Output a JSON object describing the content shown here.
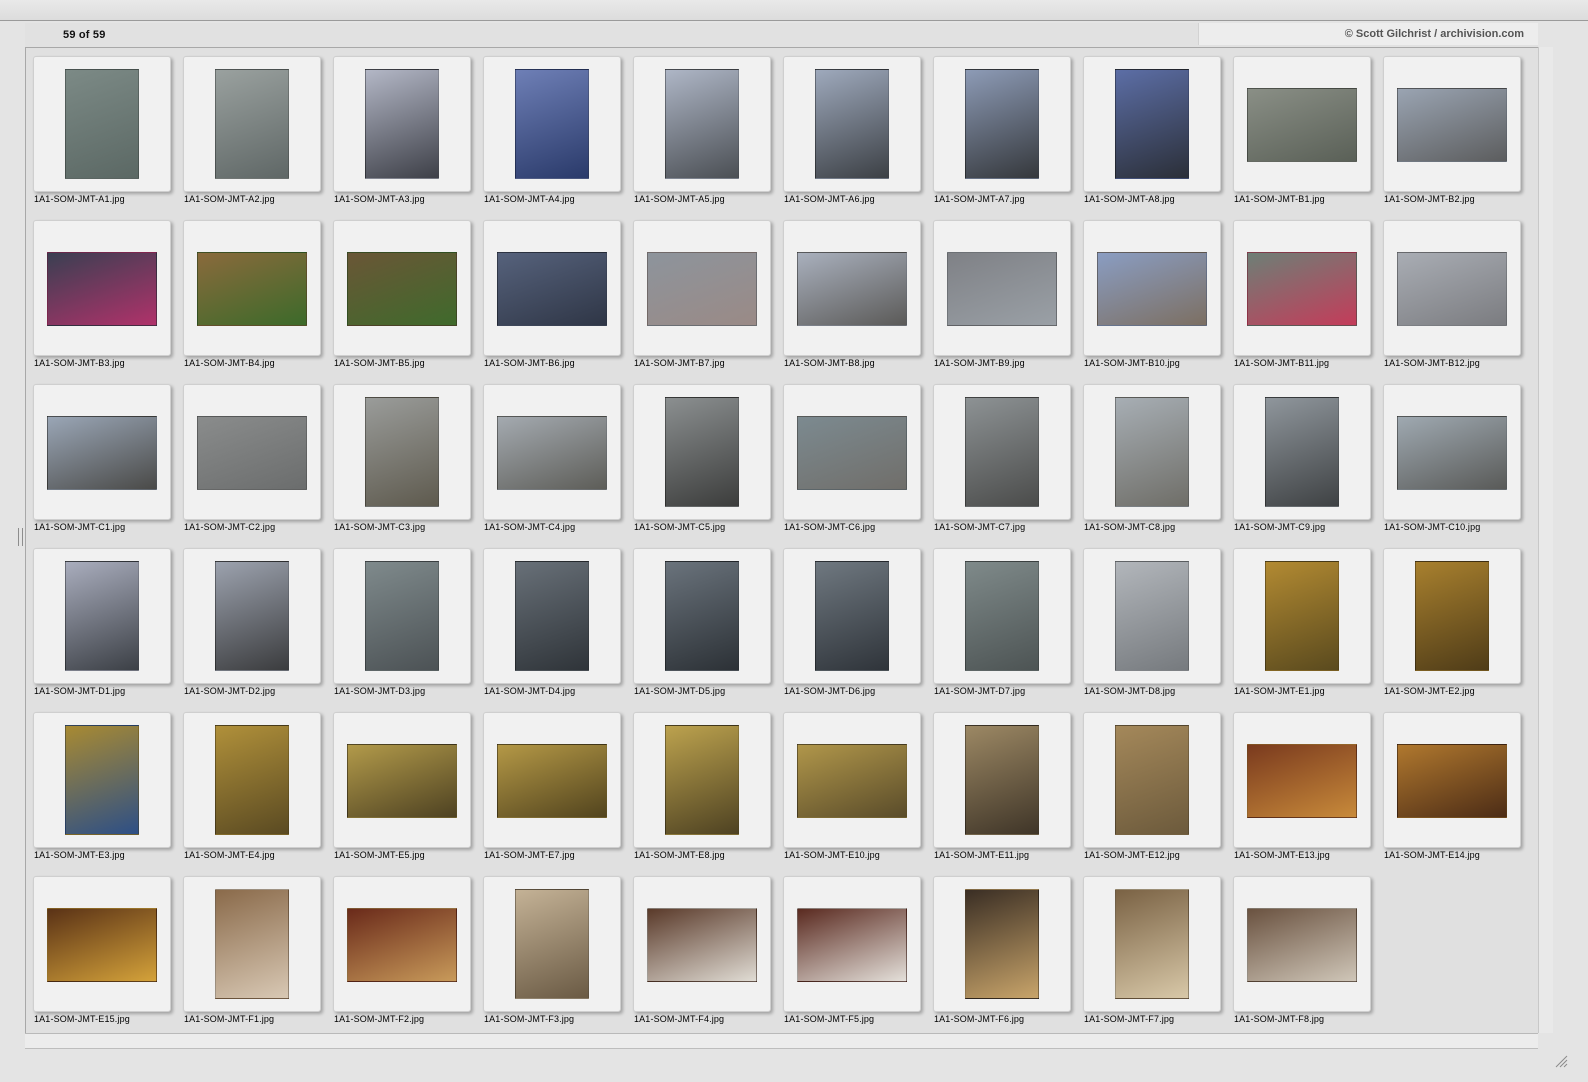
{
  "window": {
    "image_count": "59 of 59",
    "credit": "© Scott Gilchrist / archivision.com"
  },
  "thumbnails": [
    {
      "name": "1A1-SOM-JMT-A1.jpg",
      "orient": "portrait",
      "c1": "#7c8a86",
      "c2": "#5b6864"
    },
    {
      "name": "1A1-SOM-JMT-A2.jpg",
      "orient": "portrait",
      "c1": "#9aa19f",
      "c2": "#5f6766"
    },
    {
      "name": "1A1-SOM-JMT-A3.jpg",
      "orient": "portrait",
      "c1": "#b3b7c6",
      "c2": "#3e4048"
    },
    {
      "name": "1A1-SOM-JMT-A4.jpg",
      "orient": "portrait",
      "c1": "#6e7fb6",
      "c2": "#2a3a6a"
    },
    {
      "name": "1A1-SOM-JMT-A5.jpg",
      "orient": "portrait",
      "c1": "#aeb6c6",
      "c2": "#4b4f54"
    },
    {
      "name": "1A1-SOM-JMT-A6.jpg",
      "orient": "portrait",
      "c1": "#9ea9bc",
      "c2": "#3c4045"
    },
    {
      "name": "1A1-SOM-JMT-A7.jpg",
      "orient": "portrait",
      "c1": "#8d9bb6",
      "c2": "#35383c"
    },
    {
      "name": "1A1-SOM-JMT-A8.jpg",
      "orient": "portrait",
      "c1": "#5c6ea6",
      "c2": "#2b2f38"
    },
    {
      "name": "1A1-SOM-JMT-B1.jpg",
      "orient": "landscape",
      "c1": "#8a8f86",
      "c2": "#5a6057"
    },
    {
      "name": "1A1-SOM-JMT-B2.jpg",
      "orient": "landscape",
      "c1": "#9aa4b2",
      "c2": "#5c5d5e"
    },
    {
      "name": "1A1-SOM-JMT-B3.jpg",
      "orient": "landscape",
      "c1": "#3a3f52",
      "c2": "#b0326a"
    },
    {
      "name": "1A1-SOM-JMT-B4.jpg",
      "orient": "landscape",
      "c1": "#8a6a3c",
      "c2": "#3c6a2a"
    },
    {
      "name": "1A1-SOM-JMT-B5.jpg",
      "orient": "landscape",
      "c1": "#6a5636",
      "c2": "#3f6a2c"
    },
    {
      "name": "1A1-SOM-JMT-B6.jpg",
      "orient": "landscape",
      "c1": "#56627c",
      "c2": "#2f3646"
    },
    {
      "name": "1A1-SOM-JMT-B7.jpg",
      "orient": "landscape",
      "c1": "#8d949c",
      "c2": "#9a8a86"
    },
    {
      "name": "1A1-SOM-JMT-B8.jpg",
      "orient": "landscape",
      "c1": "#a9b0bd",
      "c2": "#5b5a58"
    },
    {
      "name": "1A1-SOM-JMT-B9.jpg",
      "orient": "landscape",
      "c1": "#7f8186",
      "c2": "#9aa0a6"
    },
    {
      "name": "1A1-SOM-JMT-B10.jpg",
      "orient": "landscape",
      "c1": "#8a9dc2",
      "c2": "#7c6f62"
    },
    {
      "name": "1A1-SOM-JMT-B11.jpg",
      "orient": "landscape",
      "c1": "#6d7f76",
      "c2": "#c43c5a"
    },
    {
      "name": "1A1-SOM-JMT-B12.jpg",
      "orient": "landscape",
      "c1": "#a9adb4",
      "c2": "#7b7c80"
    },
    {
      "name": "1A1-SOM-JMT-C1.jpg",
      "orient": "landscape",
      "c1": "#9aa6b6",
      "c2": "#4a4a48"
    },
    {
      "name": "1A1-SOM-JMT-C2.jpg",
      "orient": "landscape",
      "c1": "#8a8c8c",
      "c2": "#6b6d6d"
    },
    {
      "name": "1A1-SOM-JMT-C3.jpg",
      "orient": "portrait",
      "c1": "#9a9c9a",
      "c2": "#5e5a4e"
    },
    {
      "name": "1A1-SOM-JMT-C4.jpg",
      "orient": "landscape",
      "c1": "#a4aab0",
      "c2": "#5d5d58"
    },
    {
      "name": "1A1-SOM-JMT-C5.jpg",
      "orient": "portrait",
      "c1": "#8b8f90",
      "c2": "#3c3d3c"
    },
    {
      "name": "1A1-SOM-JMT-C6.jpg",
      "orient": "landscape",
      "c1": "#7c8a90",
      "c2": "#706e6a"
    },
    {
      "name": "1A1-SOM-JMT-C7.jpg",
      "orient": "portrait",
      "c1": "#8d9294",
      "c2": "#4b4c4b"
    },
    {
      "name": "1A1-SOM-JMT-C8.jpg",
      "orient": "portrait",
      "c1": "#a7aeb4",
      "c2": "#6f6e68"
    },
    {
      "name": "1A1-SOM-JMT-C9.jpg",
      "orient": "portrait",
      "c1": "#8f969c",
      "c2": "#3f4244"
    },
    {
      "name": "1A1-SOM-JMT-C10.jpg",
      "orient": "landscape",
      "c1": "#9fa9b1",
      "c2": "#595a58"
    },
    {
      "name": "1A1-SOM-JMT-D1.jpg",
      "orient": "portrait",
      "c1": "#a9adbd",
      "c2": "#3c4046"
    },
    {
      "name": "1A1-SOM-JMT-D2.jpg",
      "orient": "portrait",
      "c1": "#9ca2ae",
      "c2": "#3b3c3e"
    },
    {
      "name": "1A1-SOM-JMT-D3.jpg",
      "orient": "portrait",
      "c1": "#7f8a8c",
      "c2": "#4c5255"
    },
    {
      "name": "1A1-SOM-JMT-D4.jpg",
      "orient": "portrait",
      "c1": "#687078",
      "c2": "#2f3439"
    },
    {
      "name": "1A1-SOM-JMT-D5.jpg",
      "orient": "portrait",
      "c1": "#6a737c",
      "c2": "#2c3136"
    },
    {
      "name": "1A1-SOM-JMT-D6.jpg",
      "orient": "portrait",
      "c1": "#6f7880",
      "c2": "#2f343a"
    },
    {
      "name": "1A1-SOM-JMT-D7.jpg",
      "orient": "portrait",
      "c1": "#7f8a8a",
      "c2": "#4d5454"
    },
    {
      "name": "1A1-SOM-JMT-D8.jpg",
      "orient": "portrait",
      "c1": "#b2b6bb",
      "c2": "#767a7e"
    },
    {
      "name": "1A1-SOM-JMT-E1.jpg",
      "orient": "portrait",
      "c1": "#b28a32",
      "c2": "#5a4a1e"
    },
    {
      "name": "1A1-SOM-JMT-E2.jpg",
      "orient": "portrait",
      "c1": "#a8802e",
      "c2": "#4f3c18"
    },
    {
      "name": "1A1-SOM-JMT-E3.jpg",
      "orient": "portrait",
      "c1": "#a88a32",
      "c2": "#2d4f86"
    },
    {
      "name": "1A1-SOM-JMT-E4.jpg",
      "orient": "portrait",
      "c1": "#b0903a",
      "c2": "#5a4a22"
    },
    {
      "name": "1A1-SOM-JMT-E5.jpg",
      "orient": "landscape",
      "c1": "#b29a4a",
      "c2": "#4e4222"
    },
    {
      "name": "1A1-SOM-JMT-E7.jpg",
      "orient": "landscape",
      "c1": "#b49846",
      "c2": "#52441e"
    },
    {
      "name": "1A1-SOM-JMT-E8.jpg",
      "orient": "portrait",
      "c1": "#bca24e",
      "c2": "#4e4222"
    },
    {
      "name": "1A1-SOM-JMT-E10.jpg",
      "orient": "landscape",
      "c1": "#b0964a",
      "c2": "#5a4c2a"
    },
    {
      "name": "1A1-SOM-JMT-E11.jpg",
      "orient": "portrait",
      "c1": "#9c8864",
      "c2": "#3f3528"
    },
    {
      "name": "1A1-SOM-JMT-E12.jpg",
      "orient": "portrait",
      "c1": "#a4885a",
      "c2": "#6c5a3c"
    },
    {
      "name": "1A1-SOM-JMT-E13.jpg",
      "orient": "landscape",
      "c1": "#7a3a1e",
      "c2": "#c88a3a"
    },
    {
      "name": "1A1-SOM-JMT-E14.jpg",
      "orient": "landscape",
      "c1": "#b0782e",
      "c2": "#4c2c16"
    },
    {
      "name": "1A1-SOM-JMT-E15.jpg",
      "orient": "landscape",
      "c1": "#5a3216",
      "c2": "#d4a23a"
    },
    {
      "name": "1A1-SOM-JMT-F1.jpg",
      "orient": "portrait",
      "c1": "#8a6a4a",
      "c2": "#d8c8b4"
    },
    {
      "name": "1A1-SOM-JMT-F2.jpg",
      "orient": "landscape",
      "c1": "#6a2a1a",
      "c2": "#c89a5a"
    },
    {
      "name": "1A1-SOM-JMT-F3.jpg",
      "orient": "portrait",
      "c1": "#c4b296",
      "c2": "#6a5a44"
    },
    {
      "name": "1A1-SOM-JMT-F4.jpg",
      "orient": "landscape",
      "c1": "#5a3a2a",
      "c2": "#e0dcd4"
    },
    {
      "name": "1A1-SOM-JMT-F5.jpg",
      "orient": "landscape",
      "c1": "#5a2a20",
      "c2": "#e4e0da"
    },
    {
      "name": "1A1-SOM-JMT-F6.jpg",
      "orient": "portrait",
      "c1": "#3a2e24",
      "c2": "#c8a46a"
    },
    {
      "name": "1A1-SOM-JMT-F7.jpg",
      "orient": "portrait",
      "c1": "#7a6244",
      "c2": "#d8c8a8"
    },
    {
      "name": "1A1-SOM-JMT-F8.jpg",
      "orient": "landscape",
      "c1": "#6a5240",
      "c2": "#cfc6b8"
    }
  ]
}
